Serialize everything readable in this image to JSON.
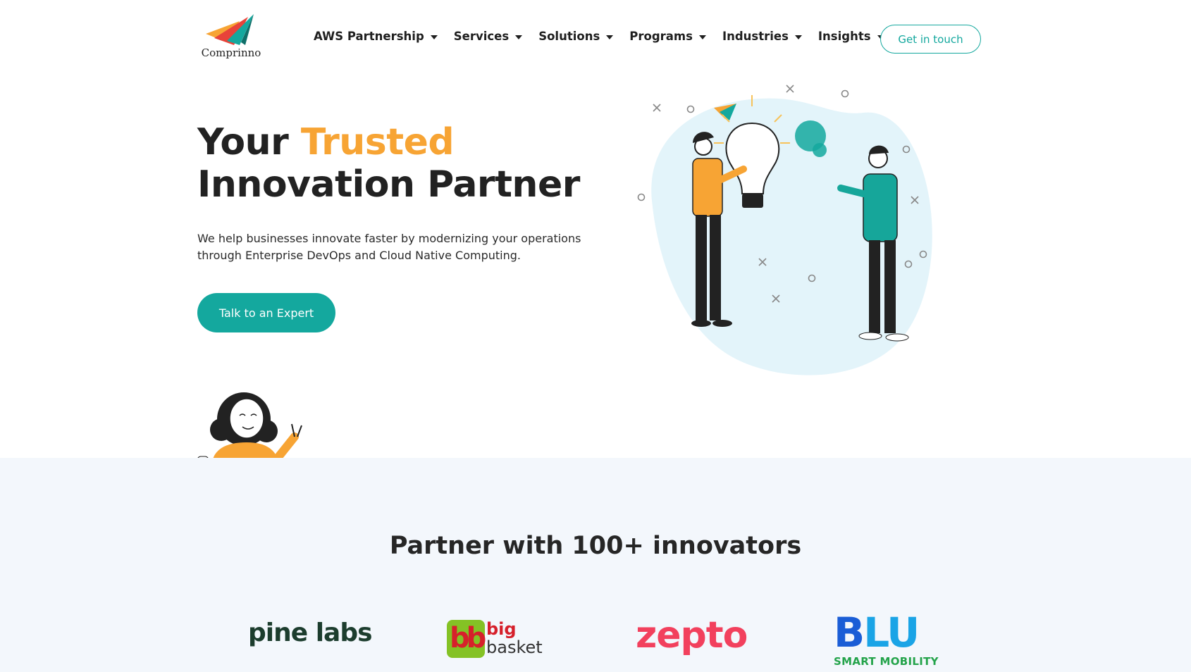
{
  "brand": {
    "name": "Comprinno",
    "logo_icon": "paper-plane-logo-icon"
  },
  "nav": {
    "items": [
      {
        "label": "AWS Partnership"
      },
      {
        "label": "Services"
      },
      {
        "label": "Solutions"
      },
      {
        "label": "Programs"
      },
      {
        "label": "Industries"
      },
      {
        "label": "Insights"
      }
    ],
    "cta_label": "Get in touch"
  },
  "hero": {
    "title_part1": "Your ",
    "title_accent": "Trusted",
    "title_part2": "Innovation Partner",
    "description": "We help businesses innovate faster by modernizing your operations through Enterprise DevOps and Cloud Native Computing.",
    "cta_label": "Talk to an Expert"
  },
  "partners": {
    "title": "Partner with 100+ innovators",
    "logos": [
      {
        "name": "pine labs"
      },
      {
        "mark": "bb",
        "word_top": "big",
        "word_bottom": "basket"
      },
      {
        "name": "zepto"
      },
      {
        "first": "B",
        "rest": "LU",
        "sub": "SMART MOBILITY"
      }
    ]
  },
  "colors": {
    "accent": "#f7a434",
    "teal": "#14a89e",
    "band_bg": "#f3f7fc",
    "illustration_bg": "#e3f4fa"
  }
}
